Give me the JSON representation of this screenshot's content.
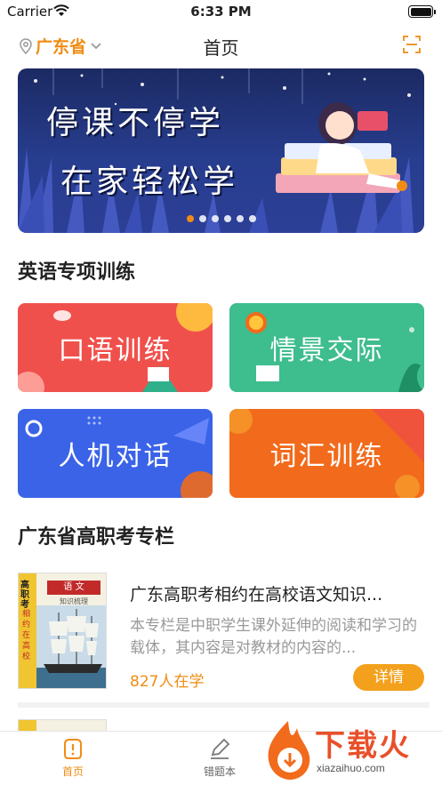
{
  "status_bar": {
    "carrier": "Carrier",
    "time": "6:33 PM"
  },
  "nav": {
    "location": "广东省",
    "title": "首页"
  },
  "banner": {
    "line1": "停课不停学",
    "line2": "在家轻松学",
    "slide_count": 6,
    "active_slide": 0
  },
  "english_section": {
    "title": "英语专项训练",
    "cards": [
      {
        "label": "口语训练",
        "color": "#f0504c"
      },
      {
        "label": "情景交际",
        "color": "#3ebd8e"
      },
      {
        "label": "人机对话",
        "color": "#3a63e8"
      },
      {
        "label": "词汇训练",
        "color": "#f26a1b"
      }
    ]
  },
  "column_section": {
    "title": "广东省高职考专栏",
    "courses": [
      {
        "title": "广东高职考相约在高校语文知识...",
        "description": "本专栏是中职学生课外延伸的阅读和学习的载体，其内容是对教材的内容的...",
        "learners": "827人在学",
        "button": "详情",
        "cover": {
          "spine": "高职考",
          "tag": "语 文",
          "subtitle": "知识梳理",
          "vertical": "相约在高校"
        }
      }
    ]
  },
  "tabbar": {
    "items": [
      {
        "label": "首页"
      },
      {
        "label": "错题本"
      }
    ]
  },
  "watermark": {
    "text": "下载火",
    "domain": "xiazaihuo.com"
  },
  "colors": {
    "accent": "#f08c14",
    "button": "#f3a11d"
  }
}
